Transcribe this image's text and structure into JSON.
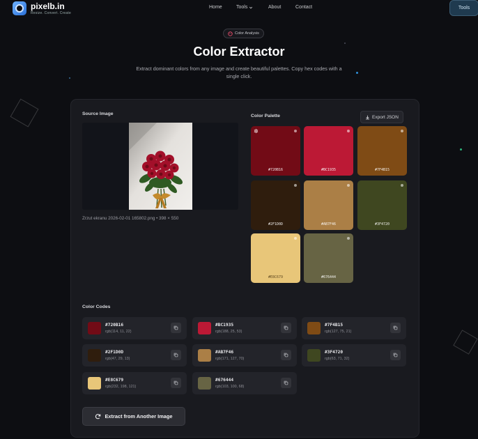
{
  "nav": {
    "brand": "pixelb.in",
    "tagline": "Resize. Convert. Create",
    "links": [
      {
        "label": "Home"
      },
      {
        "label": "Tools"
      },
      {
        "label": "About"
      },
      {
        "label": "Contact"
      }
    ],
    "tools_button": "Tools"
  },
  "hero": {
    "badge": "Color Analysis",
    "title": "Color Extractor",
    "subtitle": "Extract dominant colors from any image and create beautiful palettes. Copy hex codes with a single click."
  },
  "source": {
    "label": "Source Image",
    "caption": "Zrzut ekranu 2026-02-01 165802.png • 398 × 550"
  },
  "palette": {
    "label": "Color Palette",
    "export_label": "Export JSON",
    "swatches": [
      {
        "hex": "#720B16",
        "color": "#720B16"
      },
      {
        "hex": "#BC1935",
        "color": "#BC1935"
      },
      {
        "hex": "#7F4B15",
        "color": "#7F4B15"
      },
      {
        "hex": "#2F1D0D",
        "color": "#2F1D0D"
      },
      {
        "hex": "#AB7F46",
        "color": "#AB7F46"
      },
      {
        "hex": "#3F4720",
        "color": "#3F4720"
      },
      {
        "hex": "#E8C679",
        "color": "#E8C679"
      },
      {
        "hex": "#676444",
        "color": "#676444"
      }
    ]
  },
  "codes": {
    "label": "Color Codes",
    "items": [
      {
        "hex": "#720B16",
        "rgb": "rgb(114, 11, 22)"
      },
      {
        "hex": "#BC1935",
        "rgb": "rgb(188, 25, 53)"
      },
      {
        "hex": "#7F4B15",
        "rgb": "rgb(127, 75, 21)"
      },
      {
        "hex": "#2F1D0D",
        "rgb": "rgb(47, 29, 13)"
      },
      {
        "hex": "#AB7F46",
        "rgb": "rgb(171, 127, 70)"
      },
      {
        "hex": "#3F4720",
        "rgb": "rgb(63, 71, 32)"
      },
      {
        "hex": "#E8C679",
        "rgb": "rgb(232, 198, 121)"
      },
      {
        "hex": "#676444",
        "rgb": "rgb(103, 100, 68)"
      }
    ]
  },
  "action": {
    "extract_again": "Extract from Another Image"
  },
  "theme": {
    "background": "#0d0e12",
    "card": "#191a1f",
    "accent_tools": "#1f3a4f"
  }
}
